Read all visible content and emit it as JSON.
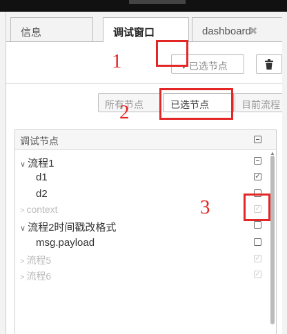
{
  "tabs": [
    {
      "label": "信息"
    },
    {
      "label": "调试窗口"
    },
    {
      "label": "dashboard"
    }
  ],
  "toolbar": {
    "filter_label": "已选节点"
  },
  "filter_options": [
    "所有节点",
    "已选节点",
    "目前流程"
  ],
  "tree": {
    "header": "调试节点",
    "rows": [
      {
        "label": "流程1",
        "type": "flow",
        "check": "minus"
      },
      {
        "label": "d1",
        "type": "node",
        "check": "checked"
      },
      {
        "label": "d2",
        "type": "node",
        "check": "unchecked"
      },
      {
        "label": "context",
        "type": "disabled-flow",
        "check": "checked"
      },
      {
        "label": "流程2时间戳改格式",
        "type": "flow",
        "check": "unchecked"
      },
      {
        "label": "msg.payload",
        "type": "node",
        "check": "unchecked"
      },
      {
        "label": "流程5",
        "type": "disabled-flow",
        "check": "checked"
      },
      {
        "label": "流程6",
        "type": "disabled-flow",
        "check": "checked"
      }
    ]
  },
  "annotations": [
    "1",
    "2",
    "3"
  ],
  "colors": {
    "annotation": "#e32626",
    "border": "#bbbbbb",
    "muted": "#bbbbbb"
  }
}
